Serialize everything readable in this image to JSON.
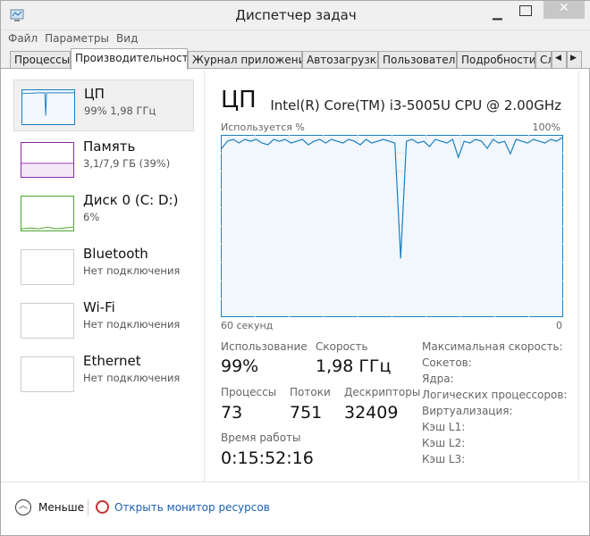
{
  "window": {
    "title": "Диспетчер задач"
  },
  "menu": [
    "Файл",
    "Параметры",
    "Вид"
  ],
  "tabs": [
    "Процессы",
    "Производительность",
    "Журнал приложений",
    "Автозагрузка",
    "Пользователи",
    "Подробности",
    "Службы"
  ],
  "sidebar": [
    {
      "name": "ЦП",
      "sub": "99%  1,98 ГГц",
      "color": "#1c7fc2"
    },
    {
      "name": "Память",
      "sub": "3,1/7,9 ГБ (39%)",
      "color": "#8b2ba8"
    },
    {
      "name": "Диск 0 (C: D:)",
      "sub": "6%",
      "color": "#4da72c"
    },
    {
      "name": "Bluetooth",
      "sub": "Нет подключения"
    },
    {
      "name": "Wi-Fi",
      "sub": "Нет подключения"
    },
    {
      "name": "Ethernet",
      "sub": "Нет подключения"
    }
  ],
  "main": {
    "title": "ЦП",
    "cpu_model": "Intel(R) Core(TM) i3-5005U CPU @ 2.00GHz",
    "graph": {
      "ylabel": "Используется %",
      "ymax_label": "100%",
      "xleft_label": "60 секунд",
      "xright_label": "0",
      "values": [
        93,
        97,
        98,
        96,
        98,
        97,
        98,
        96,
        95,
        98,
        97,
        98,
        96,
        97,
        98,
        95,
        97,
        98,
        96,
        98,
        97,
        96,
        98,
        97,
        95,
        98,
        96,
        97,
        98,
        97,
        96,
        32,
        97,
        98,
        96,
        97,
        94,
        98,
        97,
        96,
        98,
        88,
        97,
        96,
        98,
        97,
        93,
        98,
        96,
        97,
        90,
        98,
        97,
        96,
        98,
        97,
        96,
        98,
        97,
        99
      ]
    },
    "stats": {
      "usage_label": "Использование",
      "usage": "99%",
      "speed_label": "Скорость",
      "speed": "1,98 ГГц",
      "proc_label": "Процессы",
      "proc": "73",
      "threads_label": "Потоки",
      "threads": "751",
      "handles_label": "Дескрипторы",
      "handles": "32409",
      "uptime_label": "Время работы",
      "uptime": "0:15:52:16"
    },
    "info": [
      "Максимальная скорость:",
      "Сокетов:",
      "Ядра:",
      "Логических процессоров:",
      "Виртуализация:",
      "Кэш L1:",
      "Кэш L2:",
      "Кэш L3:"
    ]
  },
  "footer": {
    "less": "Меньше",
    "monitor": "Открыть монитор ресурсов"
  }
}
